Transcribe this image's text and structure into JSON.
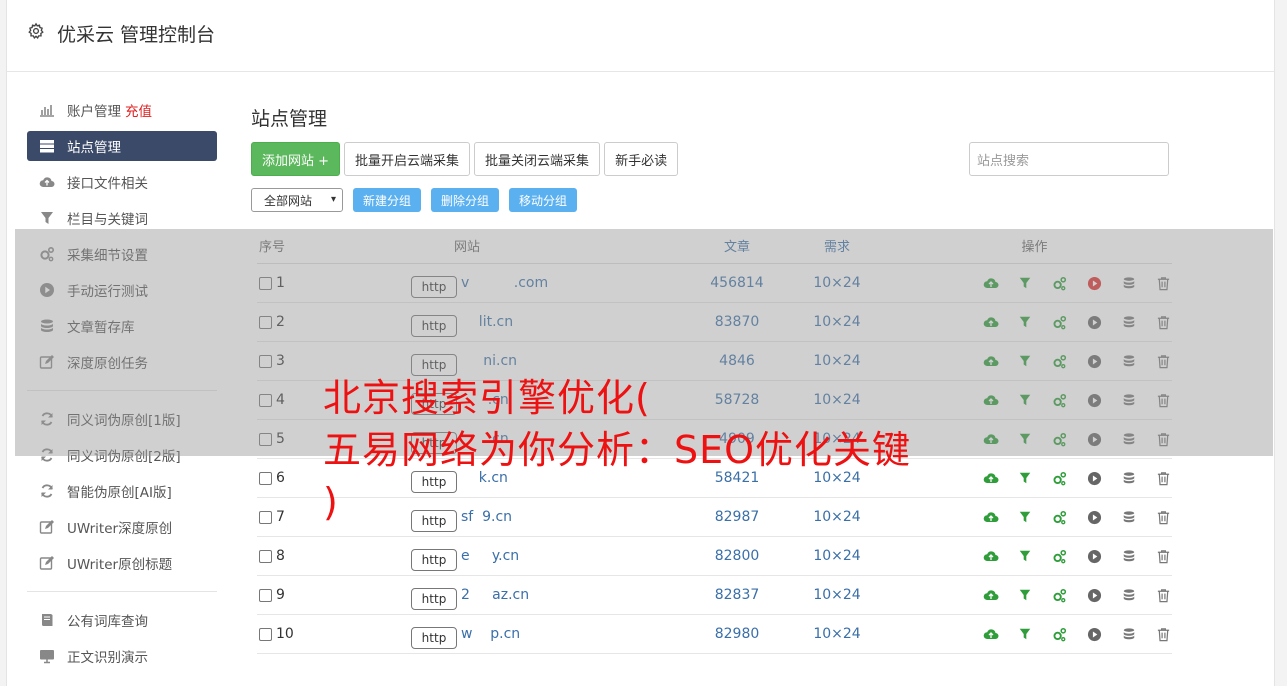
{
  "header": {
    "title": "优采云 管理控制台"
  },
  "sidebar": {
    "group1": [
      {
        "label": "账户管理",
        "extra": "充值",
        "icon": "bar-chart-icon"
      },
      {
        "label": "站点管理",
        "icon": "server-icon",
        "active": true
      },
      {
        "label": "接口文件相关",
        "icon": "cloud-upload-icon"
      },
      {
        "label": "栏目与关键词",
        "icon": "filter-icon"
      },
      {
        "label": "采集细节设置",
        "icon": "cogs-icon"
      },
      {
        "label": "手动运行测试",
        "icon": "play-icon"
      },
      {
        "label": "文章暂存库",
        "icon": "database-icon"
      },
      {
        "label": "深度原创任务",
        "icon": "edit-icon"
      }
    ],
    "group2": [
      {
        "label": "同义词伪原创[1版]",
        "icon": "refresh-icon"
      },
      {
        "label": "同义词伪原创[2版]",
        "icon": "refresh-icon"
      },
      {
        "label": "智能伪原创[AI版]",
        "icon": "refresh-icon"
      },
      {
        "label": "UWriter深度原创",
        "icon": "edit-icon"
      },
      {
        "label": "UWriter原创标题",
        "icon": "edit-icon"
      }
    ],
    "group3": [
      {
        "label": "公有词库查询",
        "icon": "book-icon"
      },
      {
        "label": "正文识别演示",
        "icon": "monitor-icon"
      }
    ]
  },
  "main": {
    "title": "站点管理",
    "buttons": {
      "add_site": "添加网站 +",
      "batch_on": "批量开启云端采集",
      "batch_off": "批量关闭云端采集",
      "guide": "新手必读"
    },
    "search_placeholder": "站点搜索",
    "group_select": "全部网站",
    "group_buttons": {
      "new": "新建分组",
      "delete": "删除分组",
      "move": "移动分组"
    }
  },
  "table": {
    "headers": {
      "no": "序号",
      "site": "网站",
      "articles": "文章",
      "demand": "需求",
      "ops": "操作"
    },
    "rows": [
      {
        "no": "1",
        "proto": "http",
        "domain": "v          .com",
        "articles": "456814",
        "demand": "10×24",
        "run_active": true
      },
      {
        "no": "2",
        "proto": "http",
        "domain": "    lit.cn",
        "articles": "83870",
        "demand": "10×24"
      },
      {
        "no": "3",
        "proto": "http",
        "domain": "     ni.cn",
        "articles": "4846",
        "demand": "10×24"
      },
      {
        "no": "4",
        "proto": "http",
        "domain": "      .cn",
        "articles": "58728",
        "demand": "10×24"
      },
      {
        "no": "5",
        "proto": "http",
        "domain": "      .cn",
        "articles": "4909",
        "demand": "10×24"
      },
      {
        "no": "6",
        "proto": "http",
        "domain": "    k.cn",
        "articles": "58421",
        "demand": "10×24"
      },
      {
        "no": "7",
        "proto": "http",
        "domain": "sf  9.cn",
        "articles": "82987",
        "demand": "10×24"
      },
      {
        "no": "8",
        "proto": "http",
        "domain": "e     y.cn",
        "articles": "82800",
        "demand": "10×24"
      },
      {
        "no": "9",
        "proto": "http",
        "domain": "2     az.cn",
        "articles": "82837",
        "demand": "10×24"
      },
      {
        "no": "10",
        "proto": "http",
        "domain": "w    p.cn",
        "articles": "82980",
        "demand": "10×24"
      }
    ]
  },
  "watermark": {
    "line1": "北京搜索引擎优化(",
    "line2": "五易网络为你分析：SEO优化关键",
    "line3": ")"
  },
  "colors": {
    "accent_green": "#5cb85c",
    "sidebar_active": "#3b4a68",
    "group_button": "#5bb0f0",
    "link": "#3a6fa8",
    "watermark": "#ee1111"
  }
}
